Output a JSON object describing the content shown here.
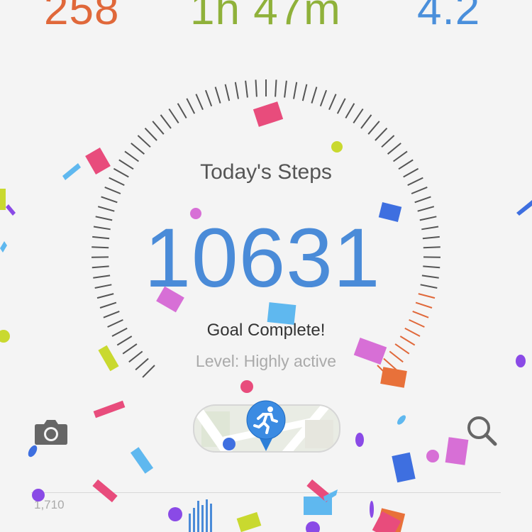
{
  "stats": {
    "calories": "258",
    "active_time": "1h 47m",
    "distance": "4.2"
  },
  "dial": {
    "title": "Today's Steps",
    "steps": "10631",
    "goal_status": "Goal Complete!",
    "level": "Level: Highly active",
    "progress_fraction": 1.0
  },
  "chart": {
    "axis_label": "1,710"
  },
  "icons": {
    "camera": "camera-icon",
    "search": "search-icon",
    "runner": "runner-pin-icon",
    "map": "map-thumbnail"
  },
  "colors": {
    "calories": "#e0683a",
    "active_time": "#8fb13a",
    "distance": "#4a8fdb",
    "steps": "#4a8bd8",
    "tick_normal": "#555555",
    "tick_accent": "#e0683a"
  }
}
